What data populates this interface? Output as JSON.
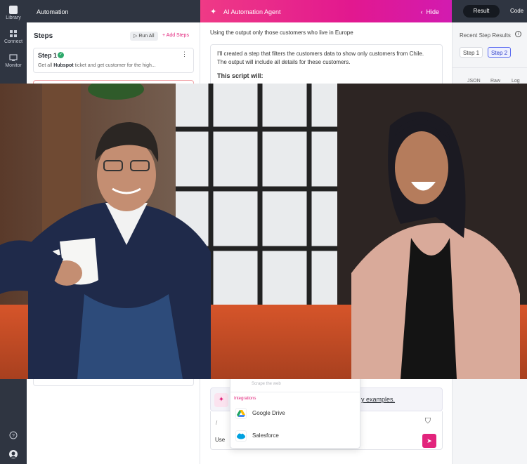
{
  "rail": {
    "items": [
      {
        "label": "Library",
        "icon": "library-icon"
      },
      {
        "label": "Connect",
        "icon": "connect-icon"
      },
      {
        "label": "Monitor",
        "icon": "monitor-icon"
      }
    ]
  },
  "header": {
    "automation_title": "Automation",
    "agent_title": "AI Automation Agent",
    "hide_label": "Hide",
    "hide_chevron": "‹",
    "tab_result": "Result",
    "tab_code": "Code"
  },
  "steps": {
    "title": "Steps",
    "run_all": "▷ Run All",
    "add_steps": "+ Add Steps",
    "step1": {
      "name": "Step 1",
      "desc_prefix": "Get all ",
      "desc_bold": "Hubspot",
      "desc_suffix": " ticket and get customer for the high..."
    }
  },
  "agent": {
    "prompt": "Using the output only those customers who live in Europe",
    "reply_line1": "I'll created a step that filters the customers data to show only customers from Chile.",
    "reply_line2": "The output will include all details for these customers.",
    "reply_heading": "This script will:",
    "examples_link": "y examples.",
    "input_slash": "/",
    "input_use": "Use"
  },
  "dropdown": {
    "faded_item": "Scrape the web",
    "section": "Integrations",
    "items": [
      "Google Drive",
      "Salesforce"
    ]
  },
  "results": {
    "title": "Recent Step Results",
    "chips": [
      "Step 1",
      "Step 2"
    ],
    "tabs": [
      "JSON",
      "Raw",
      "Log"
    ]
  },
  "colors": {
    "accent": "#e2247c",
    "rail": "#2f3541",
    "success": "#2ea96b"
  }
}
